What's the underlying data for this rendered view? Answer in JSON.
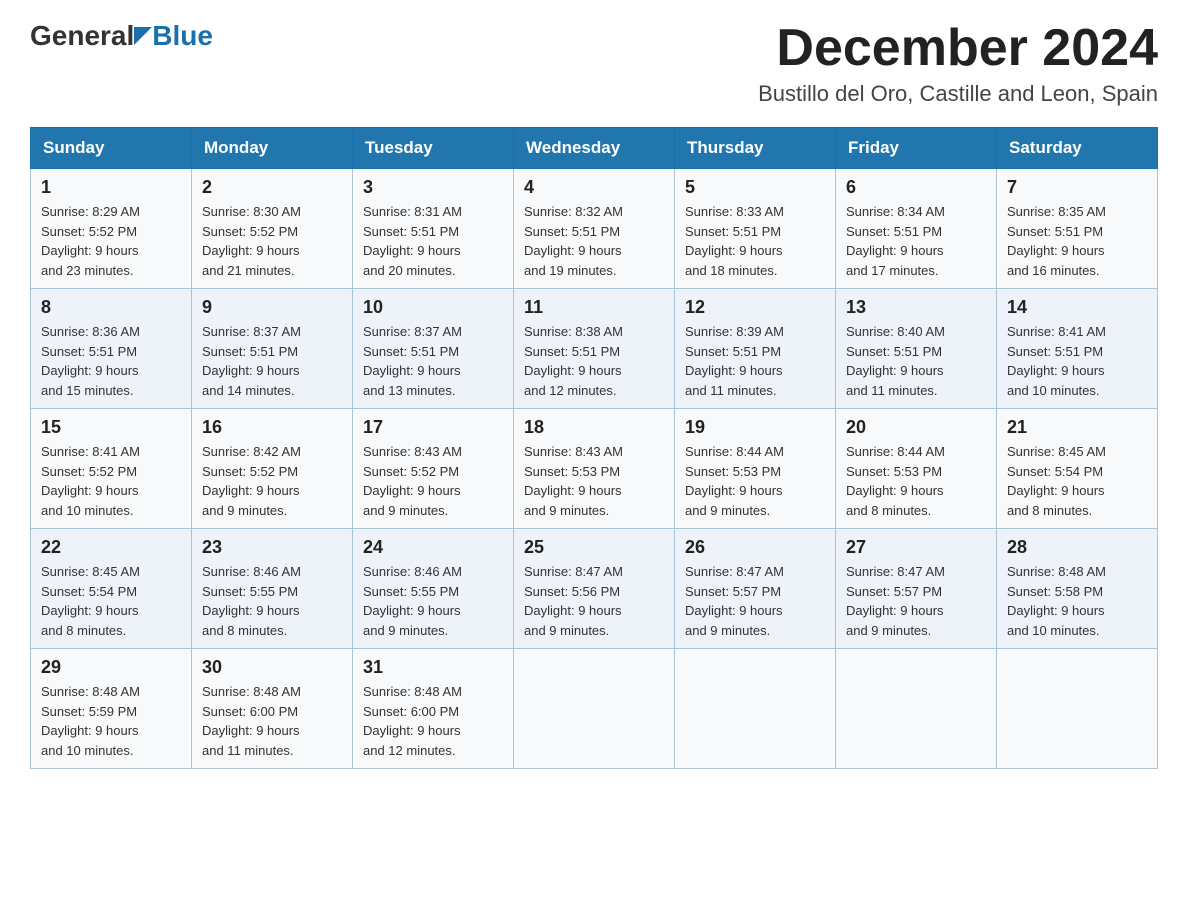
{
  "header": {
    "logo_general": "General",
    "logo_blue": "Blue",
    "month_title": "December 2024",
    "location": "Bustillo del Oro, Castille and Leon, Spain"
  },
  "weekdays": [
    "Sunday",
    "Monday",
    "Tuesday",
    "Wednesday",
    "Thursday",
    "Friday",
    "Saturday"
  ],
  "weeks": [
    [
      {
        "day": "1",
        "sunrise": "8:29 AM",
        "sunset": "5:52 PM",
        "daylight": "9 hours and 23 minutes."
      },
      {
        "day": "2",
        "sunrise": "8:30 AM",
        "sunset": "5:52 PM",
        "daylight": "9 hours and 21 minutes."
      },
      {
        "day": "3",
        "sunrise": "8:31 AM",
        "sunset": "5:51 PM",
        "daylight": "9 hours and 20 minutes."
      },
      {
        "day": "4",
        "sunrise": "8:32 AM",
        "sunset": "5:51 PM",
        "daylight": "9 hours and 19 minutes."
      },
      {
        "day": "5",
        "sunrise": "8:33 AM",
        "sunset": "5:51 PM",
        "daylight": "9 hours and 18 minutes."
      },
      {
        "day": "6",
        "sunrise": "8:34 AM",
        "sunset": "5:51 PM",
        "daylight": "9 hours and 17 minutes."
      },
      {
        "day": "7",
        "sunrise": "8:35 AM",
        "sunset": "5:51 PM",
        "daylight": "9 hours and 16 minutes."
      }
    ],
    [
      {
        "day": "8",
        "sunrise": "8:36 AM",
        "sunset": "5:51 PM",
        "daylight": "9 hours and 15 minutes."
      },
      {
        "day": "9",
        "sunrise": "8:37 AM",
        "sunset": "5:51 PM",
        "daylight": "9 hours and 14 minutes."
      },
      {
        "day": "10",
        "sunrise": "8:37 AM",
        "sunset": "5:51 PM",
        "daylight": "9 hours and 13 minutes."
      },
      {
        "day": "11",
        "sunrise": "8:38 AM",
        "sunset": "5:51 PM",
        "daylight": "9 hours and 12 minutes."
      },
      {
        "day": "12",
        "sunrise": "8:39 AM",
        "sunset": "5:51 PM",
        "daylight": "9 hours and 11 minutes."
      },
      {
        "day": "13",
        "sunrise": "8:40 AM",
        "sunset": "5:51 PM",
        "daylight": "9 hours and 11 minutes."
      },
      {
        "day": "14",
        "sunrise": "8:41 AM",
        "sunset": "5:51 PM",
        "daylight": "9 hours and 10 minutes."
      }
    ],
    [
      {
        "day": "15",
        "sunrise": "8:41 AM",
        "sunset": "5:52 PM",
        "daylight": "9 hours and 10 minutes."
      },
      {
        "day": "16",
        "sunrise": "8:42 AM",
        "sunset": "5:52 PM",
        "daylight": "9 hours and 9 minutes."
      },
      {
        "day": "17",
        "sunrise": "8:43 AM",
        "sunset": "5:52 PM",
        "daylight": "9 hours and 9 minutes."
      },
      {
        "day": "18",
        "sunrise": "8:43 AM",
        "sunset": "5:53 PM",
        "daylight": "9 hours and 9 minutes."
      },
      {
        "day": "19",
        "sunrise": "8:44 AM",
        "sunset": "5:53 PM",
        "daylight": "9 hours and 9 minutes."
      },
      {
        "day": "20",
        "sunrise": "8:44 AM",
        "sunset": "5:53 PM",
        "daylight": "9 hours and 8 minutes."
      },
      {
        "day": "21",
        "sunrise": "8:45 AM",
        "sunset": "5:54 PM",
        "daylight": "9 hours and 8 minutes."
      }
    ],
    [
      {
        "day": "22",
        "sunrise": "8:45 AM",
        "sunset": "5:54 PM",
        "daylight": "9 hours and 8 minutes."
      },
      {
        "day": "23",
        "sunrise": "8:46 AM",
        "sunset": "5:55 PM",
        "daylight": "9 hours and 8 minutes."
      },
      {
        "day": "24",
        "sunrise": "8:46 AM",
        "sunset": "5:55 PM",
        "daylight": "9 hours and 9 minutes."
      },
      {
        "day": "25",
        "sunrise": "8:47 AM",
        "sunset": "5:56 PM",
        "daylight": "9 hours and 9 minutes."
      },
      {
        "day": "26",
        "sunrise": "8:47 AM",
        "sunset": "5:57 PM",
        "daylight": "9 hours and 9 minutes."
      },
      {
        "day": "27",
        "sunrise": "8:47 AM",
        "sunset": "5:57 PM",
        "daylight": "9 hours and 9 minutes."
      },
      {
        "day": "28",
        "sunrise": "8:48 AM",
        "sunset": "5:58 PM",
        "daylight": "9 hours and 10 minutes."
      }
    ],
    [
      {
        "day": "29",
        "sunrise": "8:48 AM",
        "sunset": "5:59 PM",
        "daylight": "9 hours and 10 minutes."
      },
      {
        "day": "30",
        "sunrise": "8:48 AM",
        "sunset": "6:00 PM",
        "daylight": "9 hours and 11 minutes."
      },
      {
        "day": "31",
        "sunrise": "8:48 AM",
        "sunset": "6:00 PM",
        "daylight": "9 hours and 12 minutes."
      },
      null,
      null,
      null,
      null
    ]
  ],
  "labels": {
    "sunrise": "Sunrise:",
    "sunset": "Sunset:",
    "daylight": "Daylight:"
  }
}
